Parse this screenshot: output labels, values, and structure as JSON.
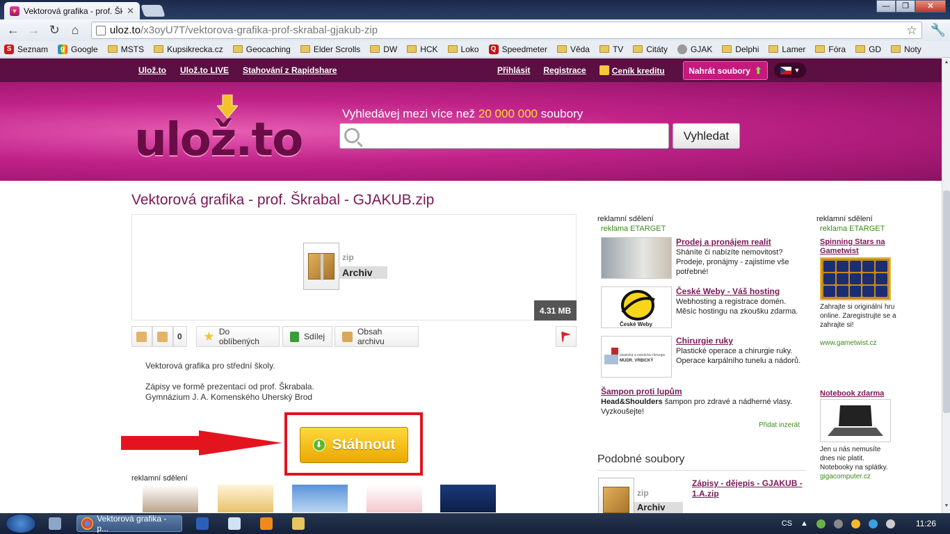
{
  "browser": {
    "tab_title": "Vektorová grafika - prof. Šk",
    "url_domain": "uloz.to",
    "url_path": "/x3oyU7T/vektorova-grafika-prof-skrabal-gjakub-zip",
    "bookmarks": [
      "Seznam",
      "Google",
      "MSTS",
      "Kupsikrecka.cz",
      "Geocaching",
      "Elder Scrolls",
      "DW",
      "HCK",
      "Loko",
      "Speedmeter",
      "Věda",
      "TV",
      "Citáty",
      "GJAK",
      "Delphi",
      "Lamer",
      "Fóra",
      "GD",
      "Noty"
    ]
  },
  "nav": {
    "left": [
      "Ulož.to",
      "Ulož.to LIVE",
      "Stahování z Rapidshare"
    ],
    "login": "Přihlásit",
    "register": "Registrace",
    "credit": "Ceník kreditu",
    "upload": "Nahrát soubory"
  },
  "header": {
    "logo": "ulož.to",
    "search_label_prefix": "Vyhledávej mezi více než",
    "search_count": "20 000 000",
    "search_label_suffix": "soubory",
    "search_button": "Vyhledat"
  },
  "file": {
    "title": "Vektorová grafika - prof. Škrabal - GJAKUB.zip",
    "ext": "zip",
    "type": "Archiv",
    "size": "4.31 MB",
    "likes": "0",
    "favorites": "Do oblíbených",
    "share": "Sdílej",
    "contents": "Obsah archivu",
    "desc1": "Vektorová grafika pro střední školy.",
    "desc2": "Zápisy ve formě prezentací od prof. Škrabala.",
    "desc3": "Gymnázium J. A. Komenského Uherský Brod",
    "download": "Stáhnout"
  },
  "ads": {
    "label": "reklamní sdělení",
    "etarget": "reklama ETARGET",
    "items": [
      {
        "title": "Prodej a pronájem realit",
        "text": "Sháníte či nabízíte nemovitost? Prodeje, pronájmy - zajistíme vše potřebné!"
      },
      {
        "title": "České Weby - Váš hosting",
        "text": "Webhosting a registrace domén. Měsíc hostingu na zkoušku zdarma."
      },
      {
        "title": "Chirurgie ruky",
        "text": "Plastické operace a chirurgie ruky. Operace karpálního tunelu a nádorů."
      }
    ],
    "shampoo_title": "Šampon proti lupům",
    "shampoo_brand": "Head&Shoulders",
    "shampoo_text": "šampon pro zdravé a nádherné vlasy. Vyzkoušejte!",
    "add_ad": "Přidat inzerát",
    "ceske_weby_logo": "České Weby",
    "chirurgie_logo_1": "plastická a estetická chirurgie",
    "chirurgie_logo_2": "MUDR. VRBICKÝ"
  },
  "similar": {
    "heading": "Podobné soubory",
    "ext": "zip",
    "type": "Archiv",
    "title": "Zápisy - dějepis - GJAKUB - 1.A.zip"
  },
  "right_col": {
    "label": "reklamní sdělení",
    "etarget": "reklama ETARGET",
    "ad1_title": "Spinning Stars na Gametwist",
    "ad1_text": "Zahrajte si originální hru online. Zaregistrujte se a zahrajte si!",
    "ad1_url": "www.gametwist.cz",
    "ad2_title": "Notebook zdarma",
    "ad2_text": "Jen u nás nemusíte dnes nic platit. Notebooky na splátky.",
    "ad2_url": "gigacomputer.cz"
  },
  "taskbar": {
    "active_window": "Vektorová grafika - p...",
    "lang": "CS",
    "time": "11:26"
  }
}
